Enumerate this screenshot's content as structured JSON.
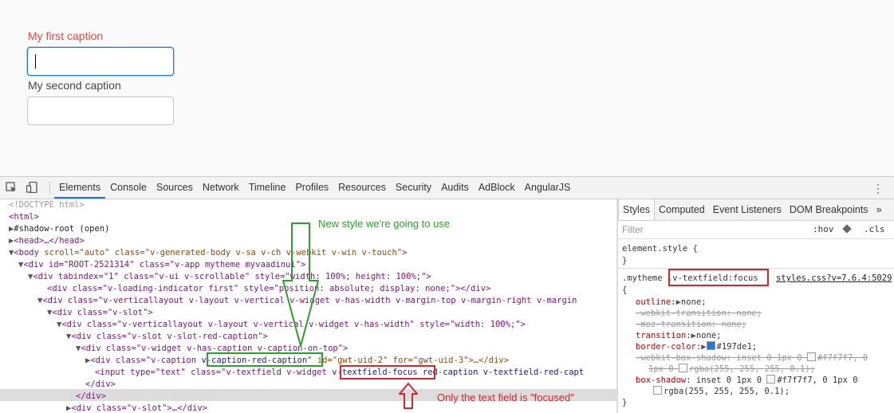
{
  "app": {
    "caption1": "My first caption",
    "caption2": "My second caption"
  },
  "devtools": {
    "tabs": [
      "Elements",
      "Console",
      "Sources",
      "Network",
      "Timeline",
      "Profiles",
      "Resources",
      "Security",
      "Audits",
      "AdBlock",
      "AngularJS"
    ],
    "active_tab": "Elements",
    "styles_tabs": [
      "Styles",
      "Computed",
      "Event Listeners",
      "DOM Breakpoints"
    ],
    "styles_more": "»",
    "filter_placeholder": "Filter",
    "hov": ":hov",
    "cls": ".cls",
    "element_style": "element.style {",
    "close_brace": "}",
    "selector_prefix": ".mytheme ",
    "selector_main": ".v-textfield:focus",
    "source_link": "styles.css?v=7.6.4:5029",
    "open_brace": "{",
    "props": {
      "outline_name": "outline",
      "outline_val": "none;",
      "webkit_transition": "-webkit-transition: none;",
      "moz_transition": "-moz-transition: none;",
      "transition_name": "transition",
      "transition_val": "none;",
      "border_color_name": "border-color",
      "border_color_val": "#197de1;",
      "webkit_box_shadow_a": "-webkit-box-shadow: inset 0 1px 0 ",
      "webkit_box_shadow_b": "#f7f7f7, 0",
      "webkit_box_shadow_c": "1px 0 ",
      "webkit_box_shadow_d": "rgba(255, 255, 255, 0.1);",
      "box_shadow_name": "box-shadow",
      "box_shadow_a": "inset 0 1px 0 ",
      "box_shadow_b": "#f7f7f7, 0 1px 0",
      "box_shadow_c": "rgba(255, 255, 255, 0.1);"
    }
  },
  "dom": {
    "doctype": "<!DOCTYPE html>",
    "html": "<html>",
    "shadow": "#shadow-root (open)",
    "head": "<head>…</head>",
    "body_tag": "<body ",
    "body_attrs": "scroll=\"auto\" class=\"v-generated-body v-sa v-ch v-webkit v-win v-touch\"",
    "root_div": "<div id=\"ROOT-2521314\" class=\"v-app mytheme myvaadinui\">",
    "scrollable": "<div tabindex=\"1\" class=\"v-ui v-scrollable\" style=\"width: 100%; height: 100%;\">",
    "loading": "<div class=\"v-loading-indicator first\" style=\"position: absolute; display: none;\"></div>",
    "vlayout1": "<div class=\"v-verticallayout v-layout v-vertical v-widget v-has-width v-margin-top v-margin-right v-margin",
    "slot1": "<div class=\"v-slot\">",
    "vlayout2": "<div class=\"v-verticallayout v-layout v-vertical v-widget v-has-width\" style=\"width: 100%;\">",
    "slot2": "<div class=\"v-slot v-slot-red-caption\">",
    "widget": "<div class=\"v-widget v-has-caption v-caption-on-top\">",
    "caption_pre": "<div class=\"v-caption ",
    "caption_cls": "v-caption-red-caption",
    "caption_post": " id=\"gwt-uid-2\" for=\"gwt-uid-3\">…</div>",
    "input_pre": "<input type=\"text\" class=\"v-textfield v-widget ",
    "input_focus": "v-textfield-focus",
    "input_post": " red-caption v-textfield-red-capt",
    "close_div1": "</div>",
    "close_div2": "</div>",
    "slot3": "<div class=\"v-slot\">…</div>"
  },
  "annotations": {
    "new_style": "New style we're going to use",
    "only_focused": "Only the text field is \"focused\""
  },
  "colors": {
    "caption_red": "#ed473b",
    "focus_blue": "#197de1",
    "annot_green": "#2ca02c",
    "annot_red": "#d7262b"
  }
}
